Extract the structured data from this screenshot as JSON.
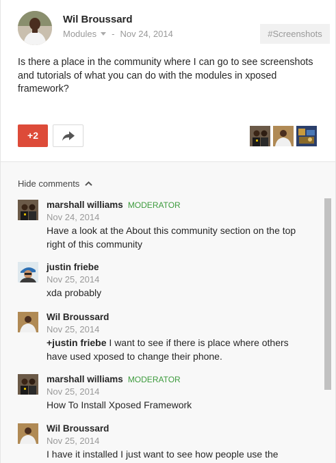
{
  "post": {
    "author": "Wil Broussard",
    "community": "Modules",
    "separator": "-",
    "date": "Nov 24, 2014",
    "hashtag": "#Screenshots",
    "text": "Is there a place in the community where I can go to see screenshots and tutorials of what you can do with the modules in xposed framework?",
    "plus_count": "+2"
  },
  "comments_section": {
    "toggle_label": "Hide comments"
  },
  "comments": [
    {
      "author": "marshall williams",
      "badge": "MODERATOR",
      "date": "Nov 24, 2014",
      "text": "Have a look at the About this community section on the top right of this community"
    },
    {
      "author": "justin friebe",
      "badge": "",
      "date": "Nov 25, 2014",
      "text": "xda probably"
    },
    {
      "author": "Wil Broussard",
      "badge": "",
      "date": "Nov 25, 2014",
      "mention": "+justin friebe",
      "text": " I want to see if there is place where others have used xposed to change their phone."
    },
    {
      "author": "marshall williams",
      "badge": "MODERATOR",
      "date": "Nov 25, 2014",
      "text": "How To Install Xposed Framework"
    },
    {
      "author": "Wil Broussard",
      "badge": "",
      "date": "Nov 25, 2014",
      "text": "I have it installed I just want to see how people use the modules and apps, looks help"
    }
  ],
  "colors": {
    "plus_button": "#dd4b39",
    "moderator_badge": "#3d9b3d",
    "comments_bg": "#f8f8f8"
  }
}
